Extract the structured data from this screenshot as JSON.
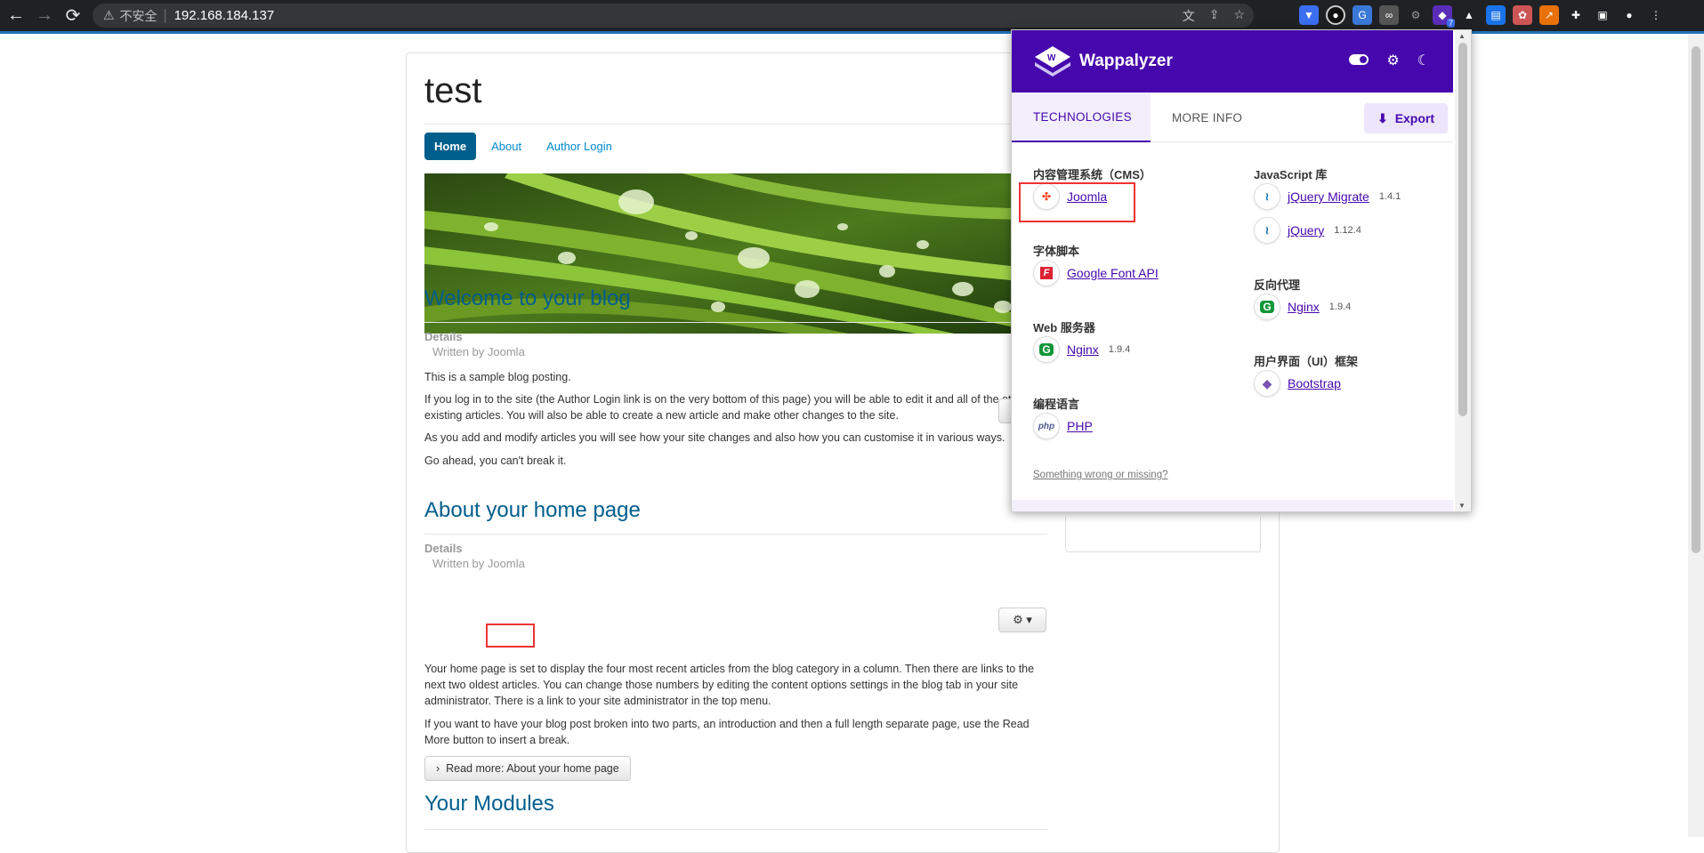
{
  "browser": {
    "insecure_label": "不安全",
    "url": "192.168.184.137",
    "extension_badge": "7"
  },
  "site": {
    "title": "test",
    "nav": [
      "Home",
      "About",
      "Author Login"
    ],
    "articles": [
      {
        "title": "Welcome to your blog",
        "details_label": "Details",
        "written_by": "Written by Joomla",
        "paragraphs": [
          "This is a sample blog posting.",
          "If you log in to the site (the Author Login link is on the very bottom of this page) you will be able to edit it and all of the other existing articles. You will also be able to create a new article and make other changes to the site.",
          "As you add and modify articles you will see how your site changes and also how you can customise it in various ways.",
          "Go ahead, you can't break it."
        ]
      },
      {
        "title": "About your home page",
        "details_label": "Details",
        "written_by_prefix": "Written by",
        "author": "Joomla",
        "paragraphs": [
          "Your home page is set to display the four most recent articles from the blog category in a column. Then there are links to the next two oldest articles. You can change those numbers by editing the content options settings in the blog tab in your site administrator. There is a link to your site administrator in the top menu.",
          "If you want to have your blog post broken into two parts, an introduction and then a full length separate page, use the Read More button to insert a break."
        ],
        "read_more": "Read more: About your home page"
      },
      {
        "title": "Your Modules"
      }
    ]
  },
  "wappalyzer": {
    "brand": "Wappalyzer",
    "tabs": [
      "TECHNOLOGIES",
      "MORE INFO"
    ],
    "export_label": "Export",
    "left_column": [
      {
        "category": "内容管理系统（CMS）",
        "items": [
          {
            "name": "Joomla",
            "version": "",
            "icon": "joomla-icon"
          }
        ]
      },
      {
        "category": "字体脚本",
        "items": [
          {
            "name": "Google Font API",
            "version": "",
            "icon": "google-font-icon"
          }
        ]
      },
      {
        "category": "Web 服务器",
        "items": [
          {
            "name": "Nginx",
            "version": "1.9.4",
            "icon": "nginx-icon"
          }
        ]
      },
      {
        "category": "编程语言",
        "items": [
          {
            "name": "PHP",
            "version": "",
            "icon": "php-icon"
          }
        ]
      }
    ],
    "right_column": [
      {
        "category": "JavaScript 库",
        "items": [
          {
            "name": "jQuery Migrate",
            "version": "1.4.1",
            "icon": "jquery-icon"
          },
          {
            "name": "jQuery",
            "version": "1.12.4",
            "icon": "jquery-icon"
          }
        ]
      },
      {
        "category": "反向代理",
        "items": [
          {
            "name": "Nginx",
            "version": "1.9.4",
            "icon": "nginx-icon"
          }
        ]
      },
      {
        "category": "用户界面（UI）框架",
        "items": [
          {
            "name": "Bootstrap",
            "version": "",
            "icon": "bootstrap-icon"
          }
        ]
      }
    ],
    "feedback_link": "Something wrong or missing?"
  },
  "colors": {
    "wappalyzer_purple": "#4608ad",
    "joomla_blue": "#005e8d",
    "highlight_red": "#e33"
  }
}
